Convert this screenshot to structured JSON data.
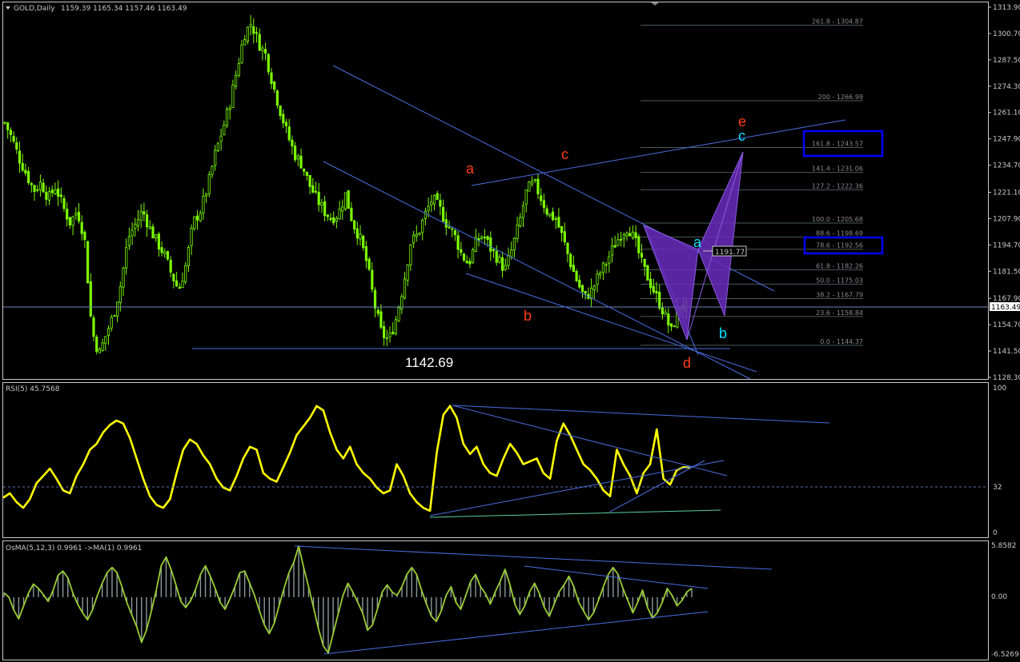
{
  "main_panel": {
    "title": "GOLD,Daily",
    "ohlc": "1159.39 1165.34 1157.46 1163.49",
    "current_price_label": "1163.49",
    "price_box_label": "1191.77",
    "low_label": "1142.69"
  },
  "rsi_panel": {
    "title": "RSI(5) 45.7568",
    "axis": [
      "100",
      "32",
      "0"
    ]
  },
  "osma_panel": {
    "title": "OsMA(5,12,3) 0.9961  ->MA(1) 0.9961",
    "axis": [
      "5.8582",
      "0.00",
      "-6.5269"
    ]
  },
  "fib_levels": [
    {
      "label": "261.8 - 1304.87",
      "price": 1304.87
    },
    {
      "label": "200 - 1266.99",
      "price": 1266.99
    },
    {
      "label": "161.8 - 1243.57",
      "price": 1243.57
    },
    {
      "label": "141.4 - 1231.06",
      "price": 1231.06
    },
    {
      "label": "127.2 - 1222.36",
      "price": 1222.36
    },
    {
      "label": "100.0 - 1205.68",
      "price": 1205.68
    },
    {
      "label": "88.6 - 1198.69",
      "price": 1198.69
    },
    {
      "label": "78.6 - 1192.56",
      "price": 1192.56
    },
    {
      "label": "61.8 - 1182.26",
      "price": 1182.26
    },
    {
      "label": "50.0 - 1175.03",
      "price": 1175.03
    },
    {
      "label": "38.2 - 1167.79",
      "price": 1167.79
    },
    {
      "label": "23.6 - 1158.84",
      "price": 1158.84
    },
    {
      "label": "0.0 - 1144.37",
      "price": 1144.37
    }
  ],
  "wave_labels": {
    "red": [
      "a",
      "b",
      "c",
      "d",
      "e"
    ],
    "cyan": [
      "a",
      "b",
      "c"
    ]
  },
  "colors": {
    "background": "#000000",
    "candle": "#7cfc00",
    "trendline": "#4a6ee0",
    "rsi": "#ffff00",
    "osma": "#9acd32",
    "pattern": "#6a2bbd",
    "box": "#0000ff",
    "wave_red": "#ff3c14",
    "wave_cyan": "#00e0ff"
  },
  "chart_data": [
    {
      "type": "candlestick",
      "title": "GOLD,Daily",
      "ylim": [
        1128.3,
        1313.9
      ],
      "yticks": [
        "1313.90",
        "1300.70",
        "1287.50",
        "1274.30",
        "1261.10",
        "1247.90",
        "1234.70",
        "1221.10",
        "1207.90",
        "1194.70",
        "1181.50",
        "1167.90",
        "1154.70",
        "1141.50",
        "1128.30"
      ],
      "close_trace": [
        1256,
        1248,
        1238,
        1230,
        1222,
        1226,
        1218,
        1224,
        1214,
        1206,
        1212,
        1198,
        1152,
        1140,
        1150,
        1160,
        1175,
        1198,
        1205,
        1212,
        1203,
        1196,
        1190,
        1180,
        1172,
        1185,
        1206,
        1212,
        1224,
        1240,
        1252,
        1265,
        1282,
        1300,
        1306,
        1296,
        1290,
        1275,
        1262,
        1250,
        1240,
        1235,
        1225,
        1218,
        1212,
        1208,
        1210,
        1220,
        1206,
        1198,
        1185,
        1165,
        1150,
        1147,
        1158,
        1175,
        1196,
        1200,
        1210,
        1218,
        1213,
        1205,
        1200,
        1190,
        1185,
        1196,
        1200,
        1193,
        1188,
        1182,
        1193,
        1206,
        1222,
        1226,
        1218,
        1210,
        1208,
        1198,
        1186,
        1176,
        1168,
        1172,
        1180,
        1186,
        1194,
        1200,
        1204,
        1196,
        1184,
        1176,
        1168,
        1160,
        1151,
        1165,
        1163.49
      ],
      "annotations": [
        "1142.69",
        "1191.77",
        "1163.49"
      ]
    },
    {
      "type": "line",
      "title": "RSI(5) 45.7568",
      "ylim": [
        0,
        100
      ],
      "level": 32,
      "values": [
        25,
        28,
        22,
        18,
        24,
        35,
        40,
        45,
        38,
        30,
        28,
        40,
        48,
        58,
        62,
        70,
        75,
        78,
        76,
        66,
        52,
        38,
        26,
        20,
        18,
        24,
        42,
        58,
        65,
        62,
        54,
        48,
        38,
        32,
        30,
        40,
        52,
        60,
        58,
        42,
        38,
        36,
        46,
        56,
        68,
        74,
        80,
        88,
        85,
        70,
        58,
        52,
        60,
        48,
        42,
        38,
        32,
        28,
        30,
        48,
        40,
        28,
        22,
        18,
        16,
        56,
        82,
        88,
        80,
        62,
        55,
        60,
        48,
        42,
        40,
        52,
        62,
        56,
        48,
        50,
        52,
        42,
        38,
        64,
        76,
        68,
        58,
        48,
        44,
        38,
        30,
        26,
        58,
        48,
        40,
        28,
        42,
        48,
        72,
        38,
        34,
        44,
        46,
        45.76
      ]
    },
    {
      "type": "bar",
      "title": "OsMA(5,12,3) 0.9961  ->MA(1) 0.9961",
      "ylim": [
        -6.5269,
        5.8582
      ],
      "values": [
        0.5,
        0.0,
        -1.5,
        -2.5,
        -1.0,
        0.5,
        1.5,
        1.0,
        0.3,
        -0.5,
        0.8,
        2.5,
        3.0,
        2.2,
        0.5,
        -0.8,
        -1.8,
        -2.6,
        -1.5,
        0.2,
        1.6,
        2.8,
        3.4,
        2.8,
        1.2,
        -0.6,
        -2.0,
        -3.4,
        -5.2,
        -3.8,
        -1.6,
        0.8,
        3.6,
        4.6,
        3.2,
        1.4,
        -0.5,
        -1.2,
        -0.4,
        0.9,
        2.6,
        3.6,
        2.4,
        1.0,
        -0.6,
        -1.4,
        -0.2,
        1.2,
        2.8,
        3.0,
        1.6,
        0.2,
        -1.6,
        -3.2,
        -4.2,
        -3.0,
        -1.0,
        1.0,
        2.8,
        4.0,
        5.86,
        3.4,
        1.2,
        -1.2,
        -3.6,
        -5.6,
        -6.4,
        -4.2,
        -2.0,
        0.2,
        1.6,
        0.6,
        -0.6,
        -1.8,
        -3.8,
        -3.2,
        -1.4,
        0.6,
        1.4,
        0.6,
        0.2,
        1.2,
        2.6,
        3.4,
        2.6,
        0.8,
        -0.8,
        -2.2,
        -2.8,
        -1.6,
        0.2,
        1.2,
        -0.6,
        -1.4,
        0.2,
        1.8,
        2.6,
        1.2,
        0.4,
        -0.8,
        0.6,
        1.8,
        3.2,
        1.4,
        -0.8,
        -2.0,
        -1.0,
        0.6,
        1.6,
        0.4,
        -1.2,
        -2.2,
        -0.8,
        0.6,
        1.4,
        2.4,
        1.2,
        -0.6,
        -1.6,
        -2.6,
        -1.8,
        -0.4,
        1.2,
        2.6,
        3.4,
        2.6,
        1.0,
        -0.4,
        -1.8,
        -0.6,
        0.8,
        -1.2,
        -2.4,
        -1.8,
        -0.6,
        1.0,
        0.2,
        -1.0,
        -0.4,
        0.6,
        0.9961
      ]
    }
  ]
}
